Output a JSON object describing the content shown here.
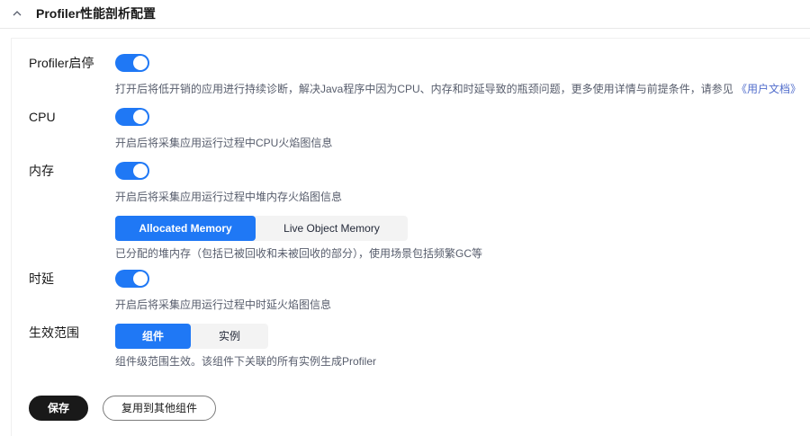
{
  "header": {
    "title": "Profiler性能剖析配置",
    "collapse_icon": "chevron-up-icon"
  },
  "settings": {
    "profiler": {
      "label": "Profiler启停",
      "enabled": true,
      "description": "打开后将低开销的应用进行持续诊断，解决Java程序中因为CPU、内存和时延导致的瓶颈问题，更多使用详情与前提条件，请参见",
      "link_text": "《用户文档》"
    },
    "cpu": {
      "label": "CPU",
      "enabled": true,
      "description": "开启后将采集应用运行过程中CPU火焰图信息"
    },
    "memory": {
      "label": "内存",
      "enabled": true,
      "description": "开启后将采集应用运行过程中堆内存火焰图信息",
      "options": [
        "Allocated Memory",
        "Live Object Memory"
      ],
      "selected": "Allocated Memory",
      "option_description": "已分配的堆内存（包括已被回收和未被回收的部分），使用场景包括频繁GC等"
    },
    "latency": {
      "label": "时延",
      "enabled": true,
      "description": "开启后将采集应用运行过程中时延火焰图信息"
    },
    "scope": {
      "label": "生效范围",
      "options": [
        "组件",
        "实例"
      ],
      "selected": "组件",
      "description": "组件级范围生效。该组件下关联的所有实例生成Profiler"
    }
  },
  "actions": {
    "save_label": "保存",
    "reuse_label": "复用到其他组件"
  },
  "colors": {
    "accent": "#1f78f5",
    "primary_button": "#191919",
    "link": "#526ecc"
  }
}
